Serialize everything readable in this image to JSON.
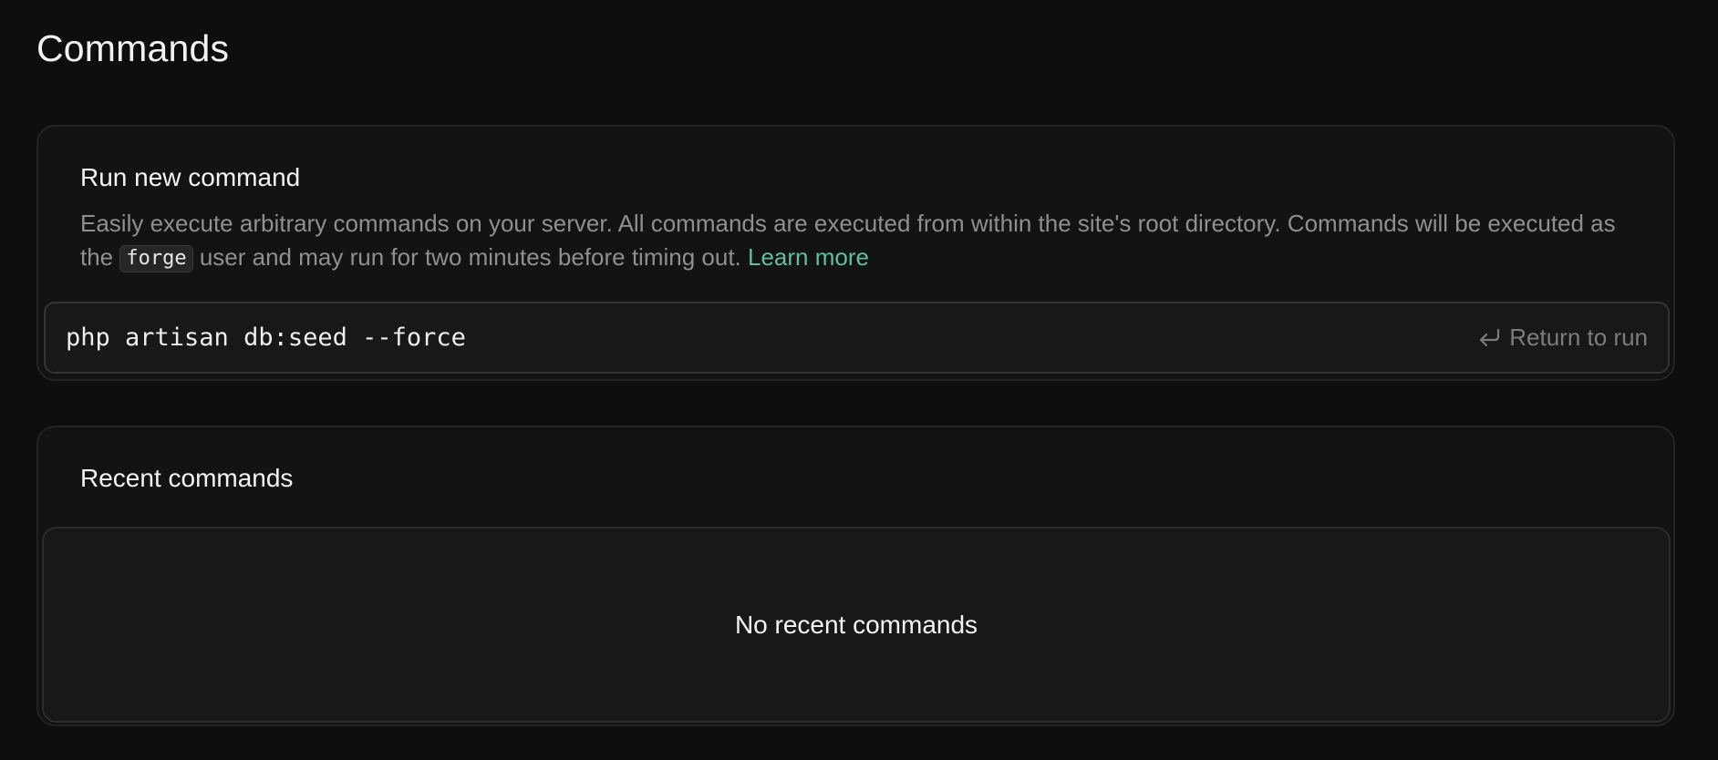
{
  "page": {
    "title": "Commands"
  },
  "run_command": {
    "heading": "Run new command",
    "description_part1": "Easily execute arbitrary commands on your server. All commands are executed from within the site's root directory. Commands will be executed as the ",
    "user_code": "forge",
    "description_part2": " user and may run for two minutes before timing out. ",
    "learn_more_label": "Learn more",
    "command_value": "php artisan db:seed --force",
    "return_hint": "Return to run",
    "return_icon": "return-arrow-icon"
  },
  "recent_commands": {
    "heading": "Recent commands",
    "empty_message": "No recent commands"
  },
  "colors": {
    "background": "#0e0e0e",
    "card": "#131313",
    "link": "#5fbf9c",
    "muted_text": "#8f8f8f"
  }
}
